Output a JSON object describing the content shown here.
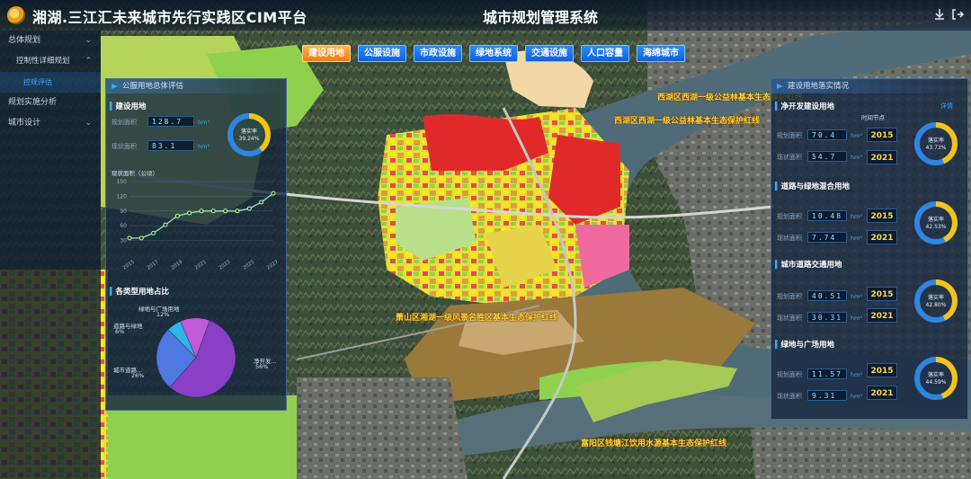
{
  "header": {
    "title_left": "湘湖.三江汇未来城市先行实践区CIM平台",
    "title_center": "城市规划管理系统"
  },
  "nav": {
    "items": [
      {
        "label": "总体规划",
        "chevron": "⌄",
        "level": 0
      },
      {
        "label": "控制性详细规划",
        "chevron": "⌃",
        "level": 1
      },
      {
        "label": "控规评估",
        "chevron": "",
        "level": 2
      },
      {
        "label": "规划实施分析",
        "chevron": "",
        "level": 0
      },
      {
        "label": "城市设计",
        "chevron": "⌄",
        "level": 0
      }
    ]
  },
  "tabs": [
    "建设用地",
    "公服设施",
    "市政设施",
    "绿地系统",
    "交通设施",
    "人口容量",
    "海绵城市"
  ],
  "map_labels": [
    "西湖区西湖一级公益林基本生态保护红线",
    "西湖区西湖一级公益林基本生态保护红线",
    "萧山区湘湖一级风景名胜区基本生态保护红线",
    "富阳区钱塘江饮用水源基本生态保护红线"
  ],
  "left_panel": {
    "title": "公服用地总体评估",
    "build": {
      "section": "建设用地",
      "plan_label": "规划面积",
      "plan_value": "128.7",
      "status_label": "现状面积",
      "status_value": "83.1",
      "unit": "hm²",
      "ring_label": "落实率",
      "ring_value": "39.24%",
      "ring_fraction": 0.3924
    },
    "trend": {
      "ylabel": "现状面积（公顷）",
      "yticks": [
        "150",
        "120",
        "90",
        "60",
        "30"
      ],
      "xticks": [
        "2015",
        "2017",
        "2019",
        "2021",
        "2023",
        "2025",
        "2027"
      ]
    },
    "pie": {
      "section": "各类型用地占比",
      "labels": {
        "green": "绿地与广场用地",
        "green_pct": "12%",
        "road": "道路与绿地",
        "road_pct": "6%",
        "city": "城市道路...",
        "city_pct": "26%",
        "pure": "净开发...",
        "pure_pct": "56%"
      }
    }
  },
  "chart_data": {
    "type": "line",
    "ylabel": "现状面积（公顷）",
    "ylim": [
      0,
      150
    ],
    "x": [
      "2015",
      "2016",
      "2017",
      "2018",
      "2019",
      "2020",
      "2021",
      "2022",
      "2023",
      "2024",
      "2025",
      "2026",
      "2027"
    ],
    "values": [
      35,
      35,
      45,
      62,
      80,
      86,
      90,
      90,
      90,
      90,
      95,
      108,
      126
    ]
  },
  "pie_data": {
    "type": "pie",
    "slices": [
      {
        "name": "净开发...",
        "value": 56,
        "color": "#8a3fc7"
      },
      {
        "name": "城市道路...",
        "value": 26,
        "color": "#4f78e0"
      },
      {
        "name": "道路与绿地",
        "value": 6,
        "color": "#2fb3e8"
      },
      {
        "name": "绿地与广场用地",
        "value": 12,
        "color": "#c05ad8"
      }
    ]
  },
  "right_panel": {
    "title": "建设用地落实情况",
    "more_label": "详情",
    "time_label": "时间节点",
    "plan_label": "规划面积",
    "status_label": "现状面积",
    "unit": "hm²",
    "ring_label": "落实率",
    "sections": [
      {
        "title": "净开发建设用地",
        "plan": "70.4",
        "status": "54.7",
        "plan_year": "2015",
        "status_year": "2021",
        "rate": "43.73%",
        "fraction": 0.4373
      },
      {
        "title": "道路与绿地混合用地",
        "plan": "10.48",
        "status": "7.74",
        "plan_year": "2015",
        "status_year": "2021",
        "rate": "42.53%",
        "fraction": 0.4253
      },
      {
        "title": "城市道路交通用地",
        "plan": "40.51",
        "status": "30.31",
        "plan_year": "2015",
        "status_year": "2021",
        "rate": "42.80%",
        "fraction": 0.428
      },
      {
        "title": "绿地与广场用地",
        "plan": "11.57",
        "status": "9.31",
        "plan_year": "2015",
        "status_year": "2021",
        "rate": "44.59%",
        "fraction": 0.4459
      }
    ]
  },
  "colors": {
    "accent": "#3aa7ff",
    "ring_fill": "#f2c418",
    "ring_track": "#2e86e0",
    "tab_active": "#f07b10",
    "tab": "#1a74ea",
    "map_label": "#ffd23a"
  }
}
